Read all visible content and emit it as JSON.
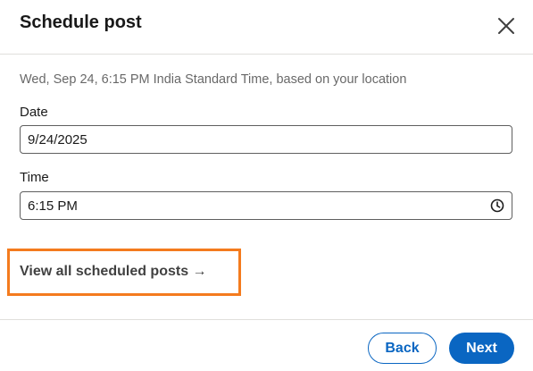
{
  "header": {
    "title": "Schedule post",
    "close_icon": "close-icon"
  },
  "timezone_note": "Wed, Sep 24, 6:15 PM India Standard Time, based on your location",
  "date_field": {
    "label": "Date",
    "value": "9/24/2025"
  },
  "time_field": {
    "label": "Time",
    "value": "6:15 PM",
    "icon": "clock-icon"
  },
  "view_link": "View all scheduled posts →",
  "buttons": {
    "back": "Back",
    "next": "Next"
  },
  "colors": {
    "primary": "#0a66c2",
    "highlight": "#f47b1e"
  }
}
